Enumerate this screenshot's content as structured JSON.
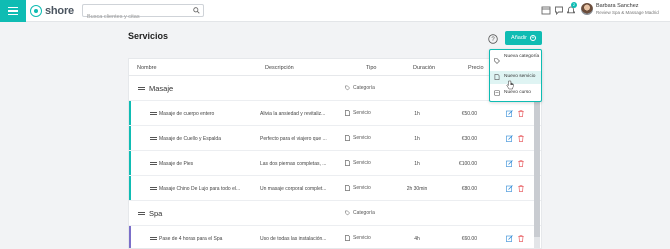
{
  "topbar": {
    "logo_text": "shore",
    "search_placeholder": "Busca clientes y citas",
    "notification_count": "2",
    "user_name": "Barbara Sanchez",
    "user_role": "Review Spa & Massage Madrid"
  },
  "page": {
    "title": "Servicios"
  },
  "add_button": {
    "label": "Añadir"
  },
  "dropdown": {
    "items": [
      {
        "label": "Nueva categoría",
        "icon": "tag-icon"
      },
      {
        "label": "Nuevo servicio",
        "icon": "document-icon"
      },
      {
        "label": "Nuevo curso",
        "icon": "course-icon"
      }
    ]
  },
  "table": {
    "headers": {
      "name": "Nombre",
      "description": "Descripción",
      "type": "Tipo",
      "duration": "Duración",
      "price": "Precio"
    },
    "category_type_label": "Categoría",
    "service_type_label": "Servicio",
    "categories": [
      {
        "name": "Masaje",
        "accent_color": "#0fbcb3",
        "services": [
          {
            "name": "Masaje de cuerpo entero",
            "description": "Alivia la ansiedad y revitaliz...",
            "duration": "1h",
            "price": "€50.00"
          },
          {
            "name": "Masaje de Cuello y Espalda",
            "description": "Perfecto para el viajero que ...",
            "duration": "1h",
            "price": "€30.00"
          },
          {
            "name": "Masaje de Pies",
            "description": "Las dos piernas completas, ...",
            "duration": "1h",
            "price": "€100.00"
          },
          {
            "name": "Masaje Chino De Lujo para todo el...",
            "description": "Un masaje corporal complet...",
            "duration": "2h 30min",
            "price": "€80.00"
          }
        ]
      },
      {
        "name": "Spa",
        "accent_color": "#7b6fc9",
        "services": [
          {
            "name": "Pase de 4 horas para el Spa",
            "description": "Uso de todas las instalación...",
            "duration": "4h",
            "price": "€60.00"
          }
        ]
      }
    ]
  },
  "colors": {
    "accent": "#0fbcb3",
    "spa_accent": "#7b6fc9",
    "delete": "#e5484d"
  }
}
